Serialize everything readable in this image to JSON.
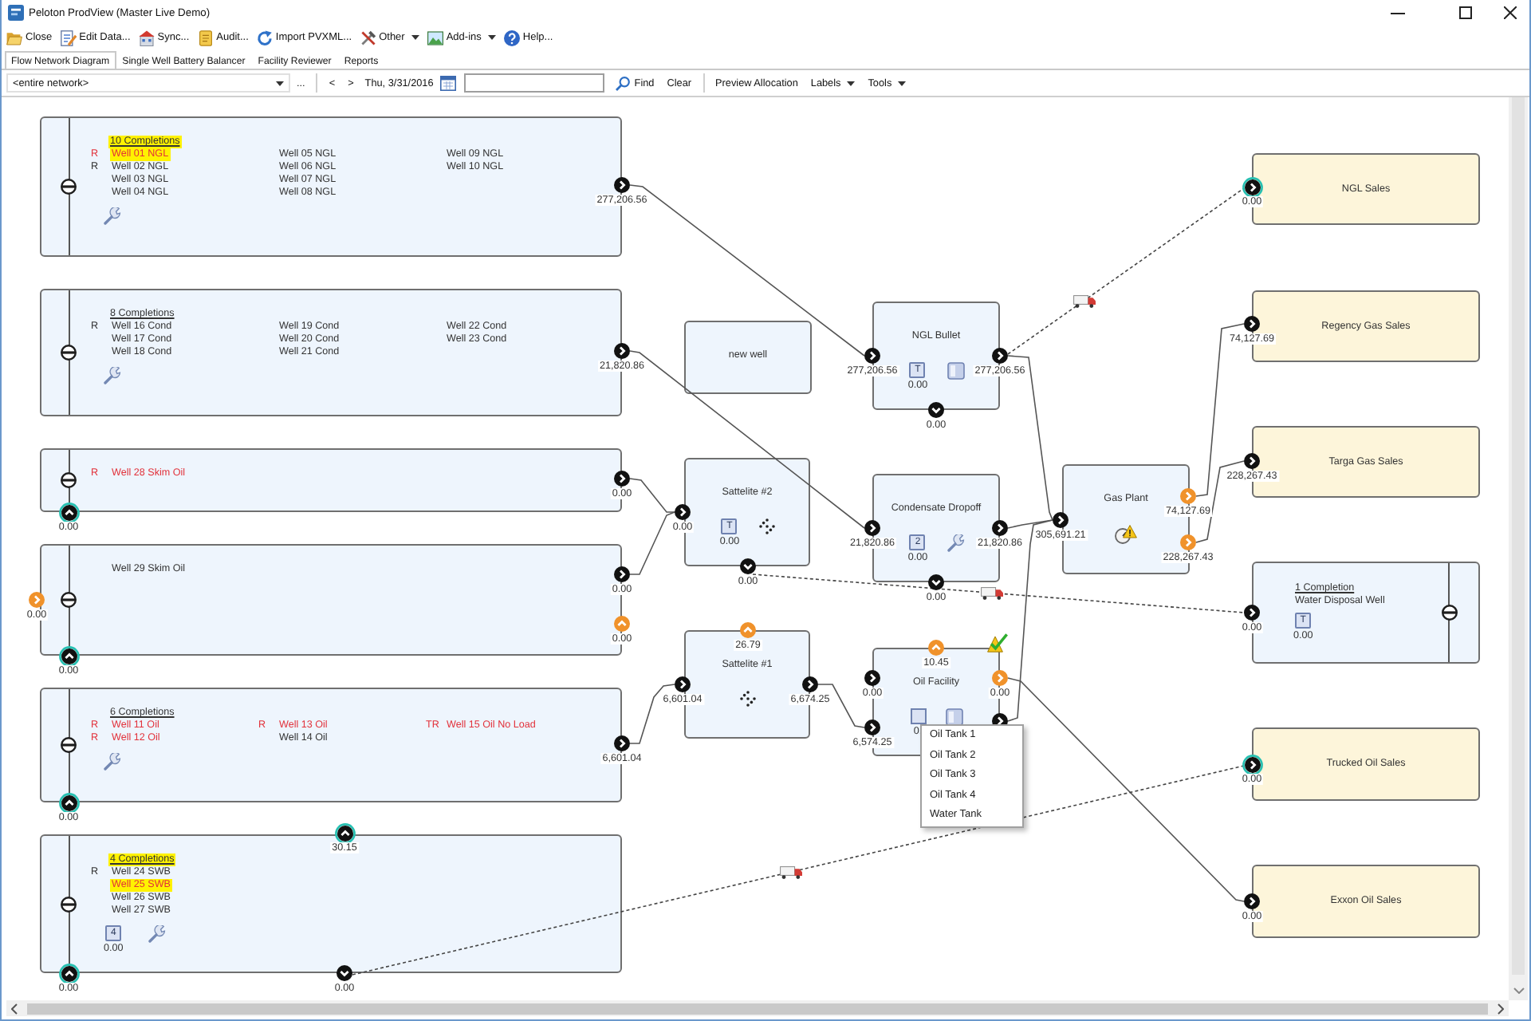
{
  "window": {
    "title": "Peloton ProdView (Master Live Demo)"
  },
  "toolbar": [
    {
      "label": "Close",
      "has_menu": false
    },
    {
      "label": "Edit Data...",
      "has_menu": false
    },
    {
      "label": "Sync...",
      "has_menu": false
    },
    {
      "label": "Audit...",
      "has_menu": false
    },
    {
      "label": "Import PVXML...",
      "has_menu": false
    },
    {
      "label": "Other",
      "has_menu": true
    },
    {
      "label": "Add-ins",
      "has_menu": true
    },
    {
      "label": "Help...",
      "has_menu": false
    }
  ],
  "tabs": [
    {
      "label": "Flow Network Diagram",
      "selected": true
    },
    {
      "label": "Single Well Battery Balancer",
      "selected": false
    },
    {
      "label": "Facility Reviewer",
      "selected": false
    },
    {
      "label": "Reports",
      "selected": false
    }
  ],
  "filter_bar": {
    "network": "<entire network>",
    "browse": "...",
    "previous": "<",
    "next": ">",
    "date": "Thu, 3/31/2016",
    "actions": [
      {
        "label": "Find",
        "kind": "search"
      },
      {
        "label": "Clear",
        "kind": "plain"
      },
      {
        "label": "Preview Allocation",
        "kind": "plain"
      },
      {
        "label": "Labels",
        "kind": "menu"
      },
      {
        "label": "Tools",
        "kind": "menu"
      }
    ]
  },
  "diagram": {
    "nodes": [
      {
        "kind": "well_group",
        "title": "10 Completions",
        "title_highlighted": true,
        "columns": [
          [
            {
              "flag": "R",
              "name": "Well 01 NGL",
              "alert": true,
              "highlighted": true
            },
            {
              "flag": "R",
              "name": "Well 02 NGL",
              "alert": false,
              "highlighted": false
            },
            {
              "name": "Well 03 NGL",
              "alert": false,
              "highlighted": false
            },
            {
              "name": "Well 04 NGL",
              "alert": false,
              "highlighted": false
            }
          ],
          [
            {
              "name": "Well 05 NGL",
              "alert": false,
              "highlighted": false
            },
            {
              "name": "Well 06 NGL",
              "alert": false,
              "highlighted": false
            },
            {
              "name": "Well 07 NGL",
              "alert": false,
              "highlighted": false
            },
            {
              "name": "Well 08 NGL",
              "alert": false,
              "highlighted": false
            }
          ],
          [
            {
              "name": "Well 09 NGL",
              "alert": false,
              "highlighted": false
            },
            {
              "name": "Well 10 NGL",
              "alert": false,
              "highlighted": false
            }
          ]
        ],
        "badges": [
          {
            "kind": "wrench"
          }
        ],
        "ports": [
          {
            "kind": "right",
            "color": "#111111",
            "linked": false,
            "value": "277,206.56"
          }
        ]
      },
      {
        "kind": "well_group",
        "title": "8 Completions",
        "title_highlighted": false,
        "columns": [
          [
            {
              "flag": "R",
              "name": "Well 16 Cond",
              "alert": false,
              "highlighted": false
            },
            {
              "name": "Well 17 Cond",
              "alert": false,
              "highlighted": false
            },
            {
              "name": "Well 18 Cond",
              "alert": false,
              "highlighted": false
            }
          ],
          [
            {
              "name": "Well 19 Cond",
              "alert": false,
              "highlighted": false
            },
            {
              "name": "Well 20 Cond",
              "alert": false,
              "highlighted": false
            },
            {
              "name": "Well 21 Cond",
              "alert": false,
              "highlighted": false
            }
          ],
          [
            {
              "name": "Well 22 Cond",
              "alert": false,
              "highlighted": false
            },
            {
              "name": "Well 23 Cond",
              "alert": false,
              "highlighted": false
            }
          ]
        ],
        "badges": [
          {
            "kind": "wrench"
          }
        ],
        "ports": [
          {
            "kind": "right",
            "color": "#111111",
            "linked": false,
            "value": "21,820.86"
          }
        ]
      },
      {
        "kind": "well_group",
        "columns": [
          [
            {
              "flag": "R",
              "name": "Well 28 Skim Oil",
              "alert": true,
              "highlighted": false
            }
          ]
        ],
        "ports": [
          {
            "kind": "right",
            "color": "#111111",
            "linked": false,
            "value": "0.00"
          },
          {
            "kind": "up",
            "color": "#111111",
            "linked": true,
            "value": "0.00"
          }
        ]
      },
      {
        "kind": "well_group",
        "columns": [
          [
            {
              "name": "Well 29 Skim Oil",
              "alert": false,
              "highlighted": false
            }
          ]
        ],
        "ports": [
          {
            "kind": "right",
            "color": "#f0922b",
            "linked": false,
            "value": "0.00"
          },
          {
            "kind": "right",
            "color": "#111111",
            "linked": false,
            "value": "0.00"
          },
          {
            "kind": "up",
            "color": "#f0922b",
            "linked": false,
            "value": "0.00"
          },
          {
            "kind": "up",
            "color": "#111111",
            "linked": true,
            "value": "0.00"
          }
        ]
      },
      {
        "kind": "well_group",
        "title": "6 Completions",
        "title_highlighted": false,
        "columns": [
          [
            {
              "flag": "R",
              "name": "Well 11 Oil",
              "alert": true,
              "highlighted": false
            },
            {
              "flag": "R",
              "name": "Well 12 Oil",
              "alert": true,
              "highlighted": false
            }
          ],
          [
            {
              "flag": "R",
              "name": "Well 13 Oil",
              "alert": true,
              "highlighted": false
            },
            {
              "name": "Well 14 Oil",
              "alert": false,
              "highlighted": false
            }
          ],
          [
            {
              "flag": "TR",
              "name": "Well 15 Oil No Load",
              "alert": true,
              "highlighted": false
            }
          ]
        ],
        "badges": [
          {
            "kind": "wrench"
          }
        ],
        "ports": [
          {
            "kind": "right",
            "color": "#111111",
            "linked": false,
            "value": "6,601.04"
          },
          {
            "kind": "up",
            "color": "#111111",
            "linked": true,
            "value": "0.00"
          }
        ]
      },
      {
        "kind": "well_group",
        "title": "4 Completions",
        "title_highlighted": true,
        "columns": [
          [
            {
              "flag": "R",
              "name": "Well 24 SWB",
              "alert": false,
              "highlighted": false
            },
            {
              "name": "Well 25 SWB",
              "alert": true,
              "highlighted": true
            },
            {
              "name": "Well 26 SWB",
              "alert": false,
              "highlighted": false
            },
            {
              "name": "Well 27 SWB",
              "alert": false,
              "highlighted": false
            }
          ]
        ],
        "badges": [
          {
            "kind": "tank",
            "symbol": "4",
            "value": "0.00"
          },
          {
            "kind": "wrench"
          }
        ],
        "ports": [
          {
            "kind": "up",
            "color": "#111111",
            "linked": true,
            "value": "30.15"
          },
          {
            "kind": "down",
            "color": "#111111",
            "linked": false,
            "value": "0.00"
          },
          {
            "kind": "up",
            "color": "#111111",
            "linked": true,
            "value": "0.00"
          }
        ]
      },
      {
        "kind": "facility",
        "title": "new well",
        "flagged": false
      },
      {
        "kind": "facility",
        "title": "Sattelite #2",
        "flagged": false,
        "badges": [
          {
            "kind": "tank",
            "symbol": "T",
            "value": "0.00"
          },
          {
            "kind": "splitter"
          }
        ],
        "ports": [
          {
            "kind": "right",
            "color": "#111111",
            "linked": false,
            "value": "0.00"
          },
          {
            "kind": "down",
            "color": "#111111",
            "linked": false,
            "value": "0.00"
          }
        ]
      },
      {
        "kind": "facility",
        "title": "Sattelite #1",
        "flagged": false,
        "badges": [
          {
            "kind": "splitter"
          }
        ],
        "ports": [
          {
            "kind": "up",
            "color": "#f0922b",
            "linked": false,
            "value": "26.79"
          },
          {
            "kind": "right",
            "color": "#111111",
            "linked": false,
            "value": "6,601.04"
          },
          {
            "kind": "right",
            "color": "#111111",
            "linked": false,
            "value": "6,674.25"
          }
        ]
      },
      {
        "kind": "facility",
        "title": "NGL Bullet",
        "flagged": false,
        "badges": [
          {
            "kind": "tank",
            "symbol": "T",
            "value": "0.00"
          },
          {
            "kind": "vessel"
          }
        ],
        "ports": [
          {
            "kind": "right",
            "color": "#111111",
            "linked": false,
            "value": "277,206.56"
          },
          {
            "kind": "right",
            "color": "#111111",
            "linked": false,
            "value": "277,206.56"
          },
          {
            "kind": "down",
            "color": "#111111",
            "linked": false,
            "value": "0.00"
          }
        ]
      },
      {
        "kind": "facility",
        "title": "Condensate Dropoff",
        "flagged": false,
        "badges": [
          {
            "kind": "tank",
            "symbol": "2",
            "value": "0.00"
          },
          {
            "kind": "wrench"
          }
        ],
        "ports": [
          {
            "kind": "right",
            "color": "#111111",
            "linked": false,
            "value": "21,820.86"
          },
          {
            "kind": "right",
            "color": "#111111",
            "linked": false,
            "value": "21,820.86"
          },
          {
            "kind": "down",
            "color": "#111111",
            "linked": false,
            "value": "0.00"
          }
        ]
      },
      {
        "kind": "facility",
        "title": "Oil Facility",
        "flagged": true,
        "badges": [
          {
            "kind": "tank",
            "value": "0."
          },
          {
            "kind": "vessel"
          }
        ],
        "ports": [
          {
            "kind": "up",
            "color": "#f0922b",
            "linked": false,
            "value": "10.45"
          },
          {
            "kind": "right",
            "color": "#111111",
            "linked": false,
            "value": "0.00"
          },
          {
            "kind": "right",
            "color": "#111111",
            "linked": false,
            "value": "6,574.25"
          },
          {
            "kind": "right",
            "color": "#f0922b",
            "linked": false,
            "value": "0.00"
          },
          {
            "kind": "right",
            "color": "#111111",
            "linked": false
          }
        ]
      },
      {
        "kind": "facility",
        "title": "Gas Plant",
        "flagged": false,
        "badges": [
          {
            "kind": "gauge_warning"
          }
        ],
        "ports": [
          {
            "kind": "right",
            "color": "#111111",
            "linked": false,
            "value": "305,691.21"
          },
          {
            "kind": "right",
            "color": "#f0922b",
            "linked": false,
            "value": "74,127.69"
          },
          {
            "kind": "right",
            "color": "#f0922b",
            "linked": false,
            "value": "228,267.43"
          }
        ]
      },
      {
        "kind": "sales",
        "title": "NGL Sales",
        "ports": [
          {
            "kind": "right",
            "color": "#111111",
            "linked": true,
            "value": "0.00"
          }
        ]
      },
      {
        "kind": "sales",
        "title": "Regency Gas Sales",
        "ports": [
          {
            "kind": "right",
            "color": "#111111",
            "linked": false,
            "value": "74,127.69"
          }
        ]
      },
      {
        "kind": "sales",
        "title": "Targa Gas Sales",
        "ports": [
          {
            "kind": "right",
            "color": "#111111",
            "linked": false,
            "value": "228,267.43"
          }
        ]
      },
      {
        "kind": "disposal_well",
        "title": "1 Completion",
        "title_highlighted": false,
        "columns": [
          [
            {
              "name": "Water Disposal Well",
              "alert": false,
              "highlighted": false
            }
          ]
        ],
        "badges": [
          {
            "kind": "tank",
            "symbol": "T",
            "value": "0.00"
          }
        ],
        "ports": [
          {
            "kind": "right",
            "color": "#111111",
            "linked": false,
            "value": "0.00"
          }
        ]
      },
      {
        "kind": "sales",
        "title": "Trucked Oil Sales",
        "ports": [
          {
            "kind": "right",
            "color": "#111111",
            "linked": true,
            "value": "0.00"
          }
        ]
      },
      {
        "kind": "sales",
        "title": "Exxon Oil Sales",
        "ports": [
          {
            "kind": "right",
            "color": "#111111",
            "linked": false,
            "value": "0.00"
          }
        ]
      }
    ],
    "connections": [
      {
        "kind": "pipeline"
      },
      {
        "kind": "pipeline"
      },
      {
        "kind": "pipeline"
      },
      {
        "kind": "pipeline"
      },
      {
        "kind": "pipeline"
      },
      {
        "kind": "pipeline"
      },
      {
        "kind": "pipeline"
      },
      {
        "kind": "pipeline"
      },
      {
        "kind": "pipeline"
      },
      {
        "kind": "pipeline"
      },
      {
        "kind": "pipeline"
      },
      {
        "kind": "pipeline"
      },
      {
        "kind": "truck"
      },
      {
        "kind": "truck"
      },
      {
        "kind": "truck"
      }
    ],
    "context_menu": {
      "items": [
        "Oil Tank 1",
        "Oil Tank 2",
        "Oil Tank 3",
        "Oil Tank 4",
        "Water Tank"
      ]
    }
  }
}
